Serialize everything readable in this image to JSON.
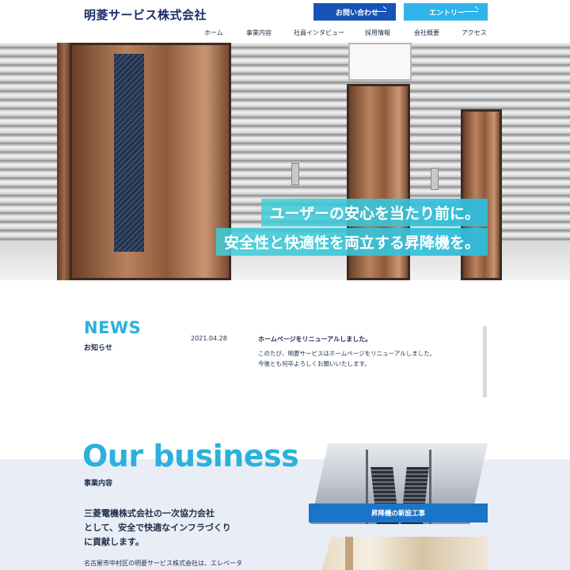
{
  "header": {
    "logo": "明菱サービス株式会社",
    "contact_label": "お問い合わせ",
    "entry_label": "エントリー",
    "nav": [
      "ホーム",
      "事業内容",
      "社員インタビュー",
      "採用情報",
      "会社概要",
      "アクセス"
    ]
  },
  "hero": {
    "line1": "ユーザーの安心を当たり前に。",
    "line2": "安全性と快適性を両立する昇降機を。"
  },
  "news": {
    "title": "NEWS",
    "subtitle": "お知らせ",
    "items": [
      {
        "date": "2021.04.28",
        "headline": "ホームページをリニューアルしました。",
        "body1": "このたび、明菱サービスはホームページをリニューアルしました。",
        "body2": "今後とも何卒よろしくお願いいたします。"
      }
    ]
  },
  "business": {
    "title": "Our business",
    "subtitle": "事業内容",
    "lead1": "三菱電機株式会社の一次協力会社",
    "lead2": "として、安全で快適なインフラづくり",
    "lead3": "に貢献します。",
    "text": "名古屋市中村区の明菱サービス株式会社は、エレベータ",
    "card1_label": "昇降機の新設工事"
  },
  "colors": {
    "accent": "#2bb1dc",
    "primary_button": "#1752b6",
    "entry_button": "#2fb3e8",
    "logo": "#1a2d6b"
  }
}
